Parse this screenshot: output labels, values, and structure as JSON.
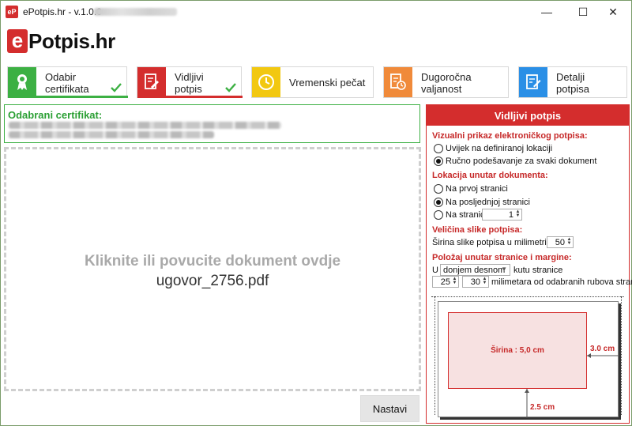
{
  "window": {
    "icon_text": "eP",
    "title": "ePotpis.hr - v.1.0.0 -",
    "minimize": "—",
    "maximize": "☐",
    "close": "✕"
  },
  "logo": {
    "e": "e",
    "rest": "Potpis.hr"
  },
  "steps": [
    {
      "line1": "Odabir",
      "line2": "certifikata",
      "color": "#3cb043",
      "done": true
    },
    {
      "line1": "Vidljivi",
      "line2": "potpis",
      "color": "#d42d2d",
      "done": true
    },
    {
      "line1": "Vremenski pečat",
      "line2": "",
      "color": "#f2c811",
      "done": false
    },
    {
      "line1": "Dugoročna",
      "line2": "valjanost",
      "color": "#f08a3a",
      "done": false
    },
    {
      "line1": "Detalji",
      "line2": "potpisa",
      "color": "#2a8fe6",
      "done": false
    }
  ],
  "certificate": {
    "label": "Odabrani certifikat:"
  },
  "dropzone": {
    "hint": "Kliknite ili povucite dokument ovdje",
    "filename": "ugovor_2756.pdf"
  },
  "buttons": {
    "next": "Nastavi"
  },
  "panel": {
    "title": "Vidljivi potpis",
    "visual": {
      "heading": "Vizualni prikaz elektroničkog potpisa:",
      "options": [
        "Uvijek na definiranoj lokaciji",
        "Ručno podešavanje za svaki dokument"
      ],
      "selected": 1
    },
    "location": {
      "heading": "Lokacija unutar dokumenta:",
      "options": [
        "Na prvoj stranici",
        "Na posljednjoj stranici",
        "Na stranici"
      ],
      "selected": 1,
      "page_number": "1"
    },
    "size": {
      "heading": "Veličina slike potpisa:",
      "width_label": "Širina slike potpisa u milimetrima:",
      "width_value": "50"
    },
    "position": {
      "heading": "Položaj unutar stranice i margine:",
      "prefix": "U",
      "corner": "donjem desnom",
      "suffix": "kutu stranice",
      "margin_1": "25",
      "margin_2": "30",
      "margin_text": "milimetara od odabranih rubova stranice"
    },
    "preview": {
      "box_label": "Širina : 5,0 cm",
      "right_margin": "3.0 cm",
      "bottom_margin": "2.5 cm"
    }
  }
}
